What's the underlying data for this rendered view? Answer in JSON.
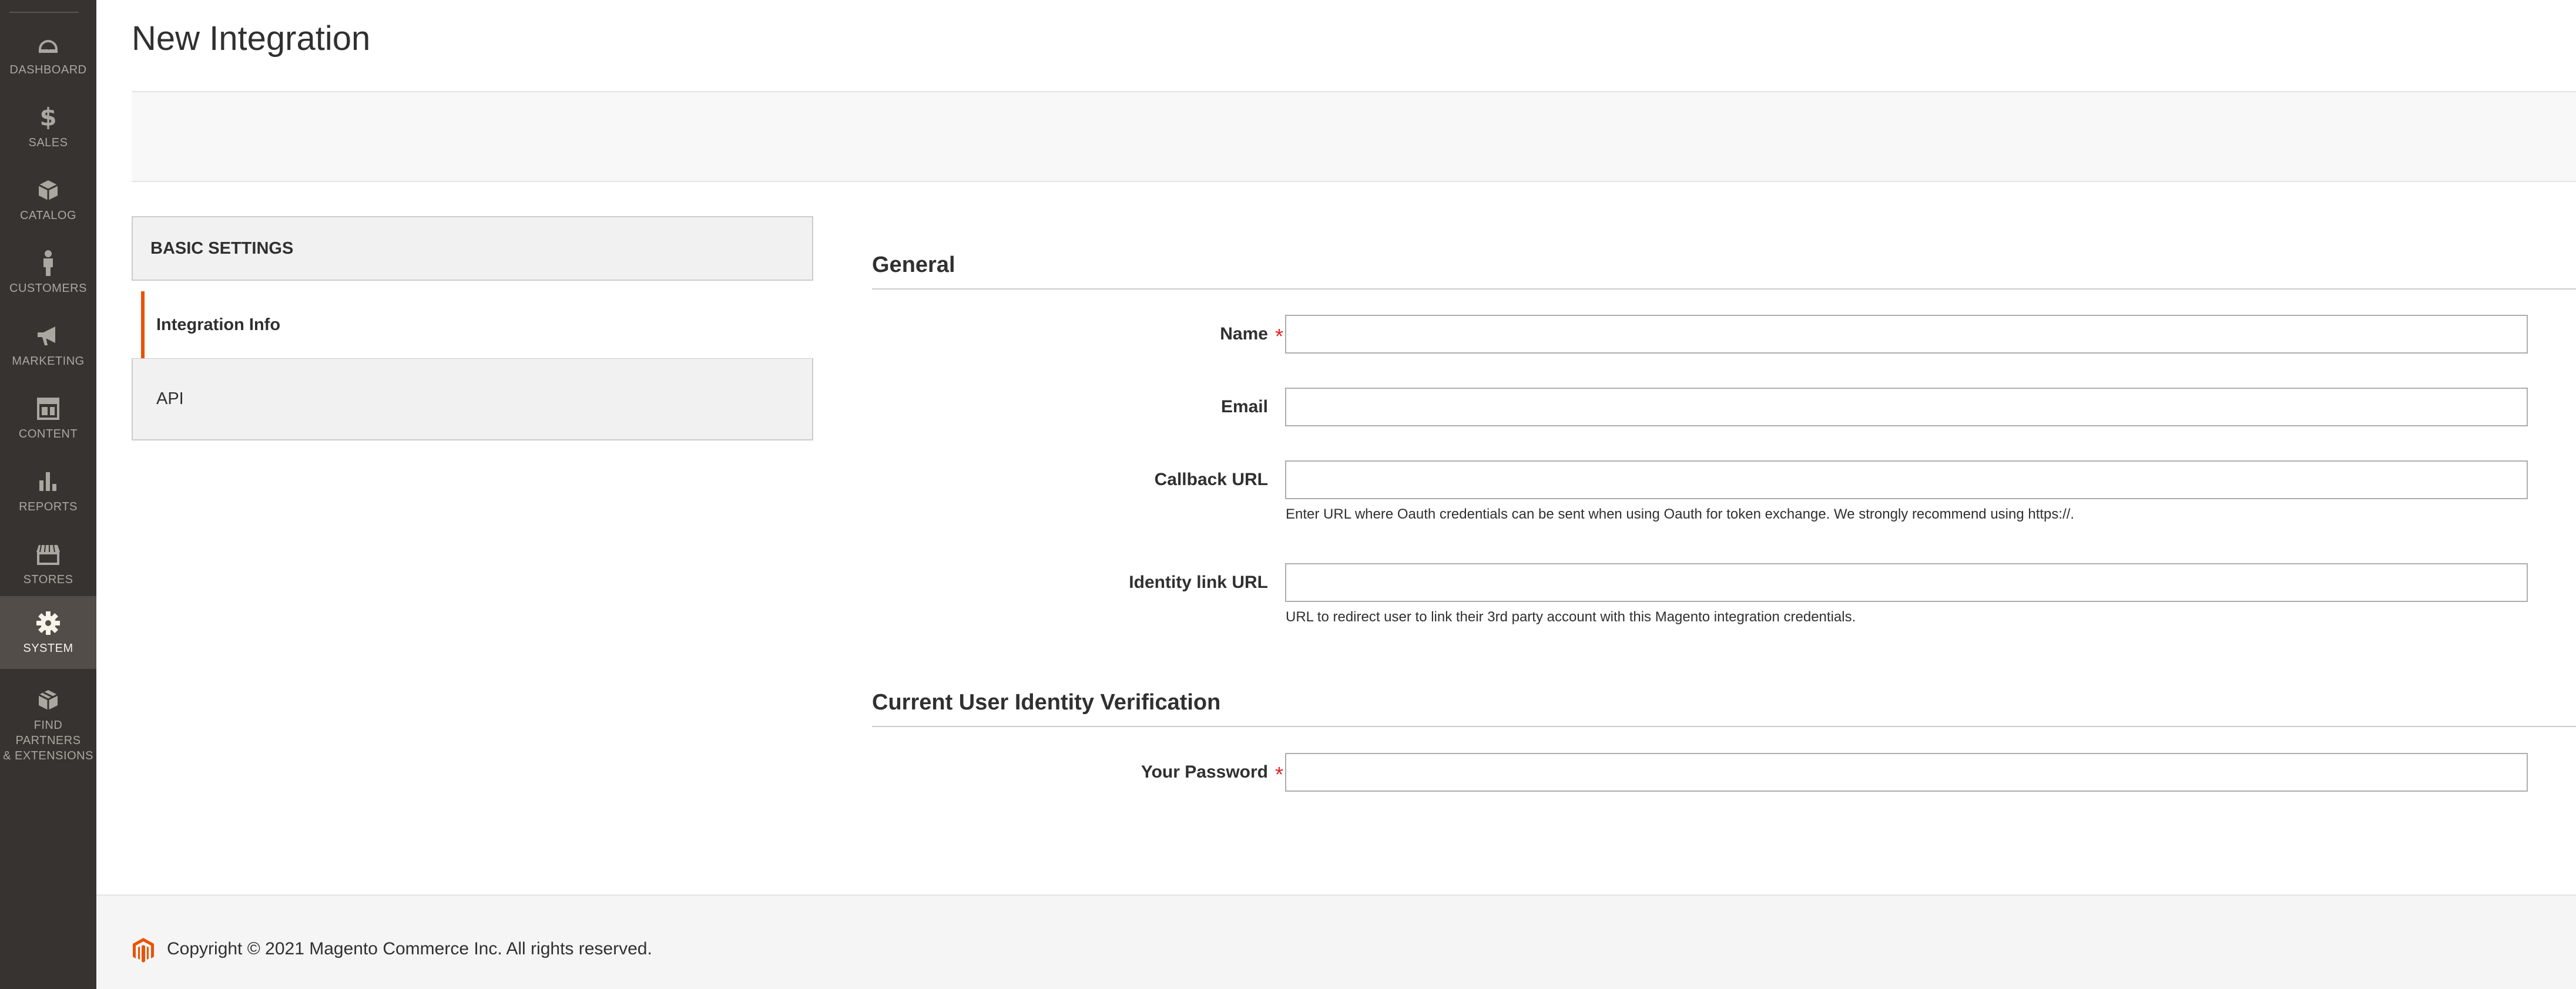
{
  "sidebar": {
    "items": [
      {
        "label": "DASHBOARD",
        "icon": "dashboard-icon",
        "active": false
      },
      {
        "label": "SALES",
        "icon": "dollar-icon",
        "active": false
      },
      {
        "label": "CATALOG",
        "icon": "box-icon",
        "active": false
      },
      {
        "label": "CUSTOMERS",
        "icon": "person-icon",
        "active": false
      },
      {
        "label": "MARKETING",
        "icon": "megaphone-icon",
        "active": false
      },
      {
        "label": "CONTENT",
        "icon": "layout-icon",
        "active": false
      },
      {
        "label": "REPORTS",
        "icon": "bar-chart-icon",
        "active": false
      },
      {
        "label": "STORES",
        "icon": "storefront-icon",
        "active": false
      },
      {
        "label": "SYSTEM",
        "icon": "gear-icon",
        "active": true
      },
      {
        "label_line1": "FIND PARTNERS",
        "label_line2": "& EXTENSIONS",
        "icon": "extensions-box-icon",
        "active": false
      }
    ]
  },
  "page": {
    "title": "New Integration"
  },
  "tabs": {
    "header": "BASIC SETTINGS",
    "items": [
      {
        "label": "Integration Info",
        "active": true
      },
      {
        "label": "API",
        "active": false
      }
    ]
  },
  "general": {
    "title": "General",
    "fields": {
      "name": {
        "label": "Name",
        "required": true,
        "value": ""
      },
      "email": {
        "label": "Email",
        "required": false,
        "value": ""
      },
      "callback_url": {
        "label": "Callback URL",
        "required": false,
        "value": "",
        "note": "Enter URL where Oauth credentials can be sent when using Oauth for token exchange. We strongly recommend using https://."
      },
      "identity_link_url": {
        "label": "Identity link URL",
        "required": false,
        "value": "",
        "note": "URL to redirect user to link their 3rd party account with this Magento integration credentials."
      }
    }
  },
  "verification": {
    "title": "Current User Identity Verification",
    "fields": {
      "password": {
        "label": "Your Password",
        "required": true,
        "value": ""
      }
    }
  },
  "footer": {
    "copyright": "Copyright © 2021 Magento Commerce Inc. All rights reserved."
  },
  "colors": {
    "accent": "#eb5202",
    "sidebar_bg": "#373330",
    "sidebar_active": "#524d49",
    "required": "#e22626"
  }
}
